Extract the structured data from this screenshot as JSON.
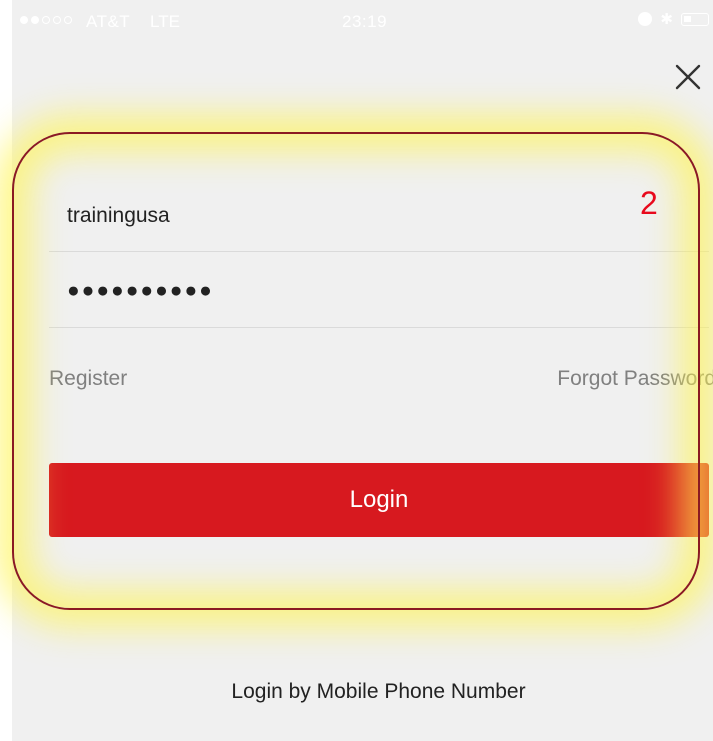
{
  "status_bar": {
    "carrier": "AT&T",
    "network": "LTE",
    "time": "23:19",
    "icons": [
      "signal-dots",
      "alarm-icon",
      "bluetooth-icon",
      "battery-icon"
    ]
  },
  "header": {
    "close_icon": "close-icon"
  },
  "login_form": {
    "username_value": "trainingusa",
    "password_value": "●●●●●●●●●●",
    "register_label": "Register",
    "forgot_password_label": "Forgot Password",
    "login_button_label": "Login"
  },
  "annotation": {
    "step_number": "2",
    "highlight_color": "#fff550",
    "outline_color": "#8b1a22",
    "number_color": "#e8091c"
  },
  "footer": {
    "phone_login_label": "Login by Mobile Phone Number"
  },
  "colors": {
    "accent": "#d7191f",
    "background": "#f0f0f0",
    "link": "#808080"
  }
}
